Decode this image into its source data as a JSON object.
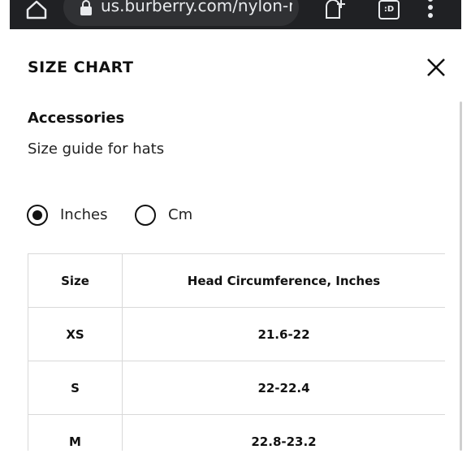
{
  "browser": {
    "url": "us.burberry.com/nylon-r",
    "tabs_label": ":D",
    "icons": [
      "home-icon",
      "lock-icon",
      "new-tab-icon",
      "tabs-icon",
      "menu-icon"
    ]
  },
  "modal": {
    "title": "SIZE CHART",
    "close_icon": "close-icon",
    "category": "Accessories",
    "description": "Size guide for hats",
    "units": {
      "options": [
        {
          "label": "Inches",
          "selected": true
        },
        {
          "label": "Cm",
          "selected": false
        }
      ]
    },
    "table": {
      "headers": [
        "Size",
        "Head Circumference, Inches"
      ],
      "rows": [
        [
          "XS",
          "21.6-22"
        ],
        [
          "S",
          "22-22.4"
        ],
        [
          "M",
          "22.8-23.2"
        ]
      ]
    }
  }
}
